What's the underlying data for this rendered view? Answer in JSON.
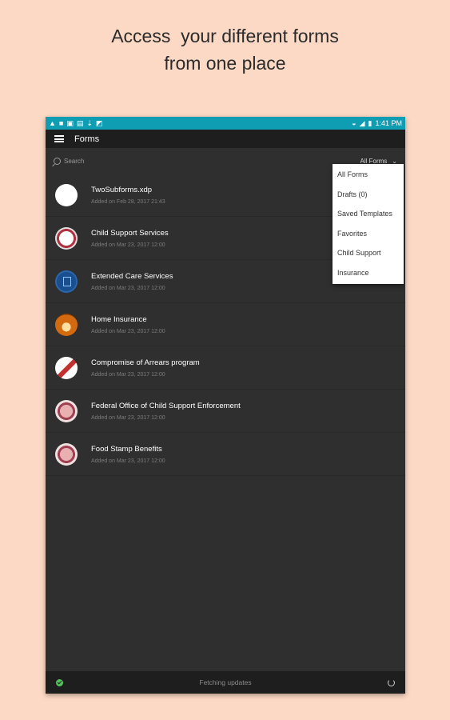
{
  "headline": [
    "Access  your different forms",
    "from one place"
  ],
  "statusbar": {
    "time": "1:41 PM"
  },
  "appbar": {
    "title": "Forms"
  },
  "search": {
    "placeholder": "Search"
  },
  "filter": {
    "label": "All Forms",
    "chevron": "chevron-down-icon"
  },
  "forms": [
    {
      "title": "TwoSubforms.xdp",
      "subtitle": "Added on Feb 28, 2017 21:43",
      "icon": "blank-circle-icon"
    },
    {
      "title": "Child Support Services",
      "subtitle": "Added on Mar 23, 2017 12:00",
      "icon": "seal-icon"
    },
    {
      "title": "Extended Care Services",
      "subtitle": "Added on Mar 23, 2017 12:00",
      "icon": "document-icon"
    },
    {
      "title": "Home Insurance",
      "subtitle": "Added on Mar 23, 2017 12:00",
      "icon": "house-icon"
    },
    {
      "title": "Compromise of Arrears program",
      "subtitle": "Added on Mar 23, 2017 12:00",
      "icon": "seal-icon"
    },
    {
      "title": "Federal Office of Child Support Enforcement",
      "subtitle": "Added on Mar 23, 2017 12:00",
      "icon": "seal-icon"
    },
    {
      "title": "Food Stamp Benefits",
      "subtitle": "Added on Mar 23, 2017 12:00",
      "icon": "seal-icon"
    }
  ],
  "dropdown": [
    "All Forms",
    "Drafts (0)",
    "Saved Templates",
    "Favorites",
    "Child Support",
    "Insurance"
  ],
  "footer": {
    "status": "Fetching updates"
  }
}
